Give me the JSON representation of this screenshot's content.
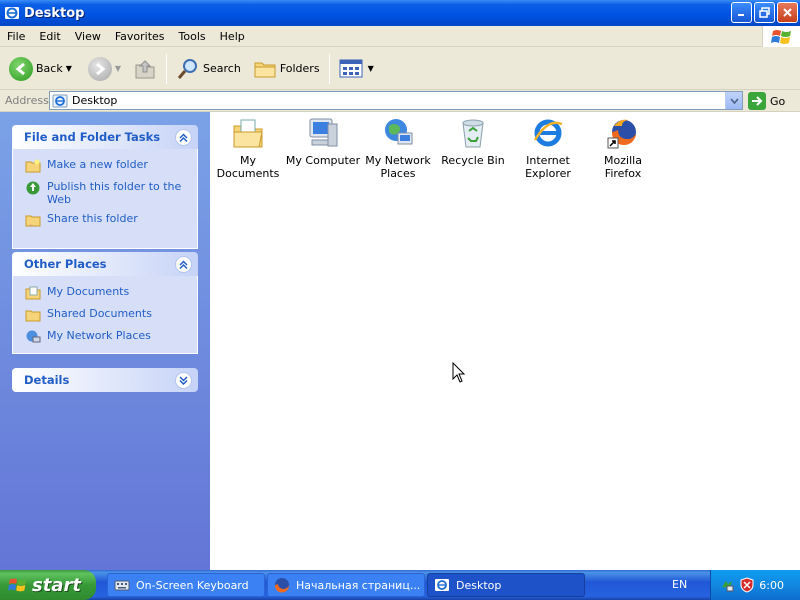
{
  "window": {
    "title": "Desktop"
  },
  "menu": [
    "File",
    "Edit",
    "View",
    "Favorites",
    "Tools",
    "Help"
  ],
  "toolbar": {
    "back": "Back",
    "search": "Search",
    "folders": "Folders"
  },
  "address": {
    "label": "Address",
    "value": "Desktop",
    "go": "Go"
  },
  "panels": {
    "file_tasks": {
      "title": "File and Folder Tasks",
      "items": [
        "Make a new folder",
        "Publish this folder to the Web",
        "Share this folder"
      ]
    },
    "other_places": {
      "title": "Other Places",
      "items": [
        "My Documents",
        "Shared Documents",
        "My Network Places"
      ]
    },
    "details": {
      "title": "Details"
    }
  },
  "desktop_icons": [
    {
      "label": "My Documents",
      "icon": "my-documents-icon"
    },
    {
      "label": "My Computer",
      "icon": "my-computer-icon"
    },
    {
      "label": "My Network Places",
      "icon": "network-places-icon"
    },
    {
      "label": "Recycle Bin",
      "icon": "recycle-bin-icon"
    },
    {
      "label": "Internet Explorer",
      "icon": "internet-explorer-icon"
    },
    {
      "label": "Mozilla Firefox",
      "icon": "firefox-icon"
    }
  ],
  "taskbar": {
    "start": "start",
    "items": [
      {
        "label": "On-Screen Keyboard",
        "icon": "keyboard-icon"
      },
      {
        "label": "Начальная страниц...",
        "icon": "firefox-icon"
      },
      {
        "label": "Desktop",
        "icon": "ie-folder-icon"
      }
    ],
    "language": "EN",
    "clock": "6:00"
  },
  "colors": {
    "title_blue": "#0054e3",
    "task_pane": "#6375d6",
    "link_blue": "#215dc6",
    "start_green": "#3c9a3c"
  }
}
